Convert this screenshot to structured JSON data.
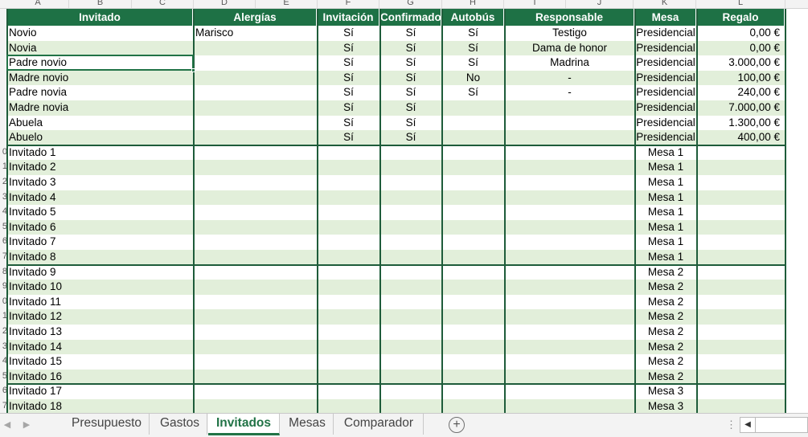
{
  "columns": [
    "A",
    "B",
    "C",
    "D",
    "E",
    "F",
    "G",
    "H",
    "I",
    "J",
    "K",
    "L"
  ],
  "headers": {
    "invitado": "Invitado",
    "alergias": "Alergías",
    "invitacion": "Invitación",
    "confirmado": "Confirmado",
    "autobus": "Autobús",
    "responsable": "Responsable",
    "mesa": "Mesa",
    "regalo": "Regalo"
  },
  "row_numbers": [
    "",
    "",
    "",
    "",
    "",
    "",
    "",
    "",
    "",
    "0",
    "1",
    "2",
    "3",
    "4",
    "5",
    "6",
    "7",
    "8",
    "9",
    "0",
    "1",
    "2",
    "3",
    "4",
    "5",
    "6",
    "7"
  ],
  "rows": [
    {
      "invitado": "Novio",
      "alergias": "Marisco",
      "invitacion": "Sí",
      "confirmado": "Sí",
      "autobus": "Sí",
      "responsable": "Testigo",
      "mesa": "Presidencial",
      "regalo": "0,00 €"
    },
    {
      "invitado": "Novia",
      "alergias": "",
      "invitacion": "Sí",
      "confirmado": "Sí",
      "autobus": "Sí",
      "responsable": "Dama de honor",
      "mesa": "Presidencial",
      "regalo": "0,00 €"
    },
    {
      "invitado": "Padre novio",
      "alergias": "",
      "invitacion": "Sí",
      "confirmado": "Sí",
      "autobus": "Sí",
      "responsable": "Madrina",
      "mesa": "Presidencial",
      "regalo": "3.000,00 €"
    },
    {
      "invitado": "Madre novio",
      "alergias": "",
      "invitacion": "Sí",
      "confirmado": "Sí",
      "autobus": "No",
      "responsable": "-",
      "mesa": "Presidencial",
      "regalo": "100,00 €"
    },
    {
      "invitado": "Padre novia",
      "alergias": "",
      "invitacion": "Sí",
      "confirmado": "Sí",
      "autobus": "Sí",
      "responsable": "-",
      "mesa": "Presidencial",
      "regalo": "240,00 €"
    },
    {
      "invitado": "Madre novia",
      "alergias": "",
      "invitacion": "Sí",
      "confirmado": "Sí",
      "autobus": "",
      "responsable": "",
      "mesa": "Presidencial",
      "regalo": "7.000,00 €"
    },
    {
      "invitado": "Abuela",
      "alergias": "",
      "invitacion": "Sí",
      "confirmado": "Sí",
      "autobus": "",
      "responsable": "",
      "mesa": "Presidencial",
      "regalo": "1.300,00 €"
    },
    {
      "invitado": "Abuelo",
      "alergias": "",
      "invitacion": "Sí",
      "confirmado": "Sí",
      "autobus": "",
      "responsable": "",
      "mesa": "Presidencial",
      "regalo": "400,00 €"
    },
    {
      "invitado": "Invitado 1",
      "alergias": "",
      "invitacion": "",
      "confirmado": "",
      "autobus": "",
      "responsable": "",
      "mesa": "Mesa 1",
      "regalo": ""
    },
    {
      "invitado": "Invitado 2",
      "alergias": "",
      "invitacion": "",
      "confirmado": "",
      "autobus": "",
      "responsable": "",
      "mesa": "Mesa 1",
      "regalo": ""
    },
    {
      "invitado": "Invitado 3",
      "alergias": "",
      "invitacion": "",
      "confirmado": "",
      "autobus": "",
      "responsable": "",
      "mesa": "Mesa 1",
      "regalo": ""
    },
    {
      "invitado": "Invitado 4",
      "alergias": "",
      "invitacion": "",
      "confirmado": "",
      "autobus": "",
      "responsable": "",
      "mesa": "Mesa 1",
      "regalo": ""
    },
    {
      "invitado": "Invitado 5",
      "alergias": "",
      "invitacion": "",
      "confirmado": "",
      "autobus": "",
      "responsable": "",
      "mesa": "Mesa 1",
      "regalo": ""
    },
    {
      "invitado": "Invitado 6",
      "alergias": "",
      "invitacion": "",
      "confirmado": "",
      "autobus": "",
      "responsable": "",
      "mesa": "Mesa 1",
      "regalo": ""
    },
    {
      "invitado": "Invitado 7",
      "alergias": "",
      "invitacion": "",
      "confirmado": "",
      "autobus": "",
      "responsable": "",
      "mesa": "Mesa 1",
      "regalo": ""
    },
    {
      "invitado": "Invitado 8",
      "alergias": "",
      "invitacion": "",
      "confirmado": "",
      "autobus": "",
      "responsable": "",
      "mesa": "Mesa 1",
      "regalo": ""
    },
    {
      "invitado": "Invitado 9",
      "alergias": "",
      "invitacion": "",
      "confirmado": "",
      "autobus": "",
      "responsable": "",
      "mesa": "Mesa 2",
      "regalo": ""
    },
    {
      "invitado": "Invitado 10",
      "alergias": "",
      "invitacion": "",
      "confirmado": "",
      "autobus": "",
      "responsable": "",
      "mesa": "Mesa 2",
      "regalo": ""
    },
    {
      "invitado": "Invitado 11",
      "alergias": "",
      "invitacion": "",
      "confirmado": "",
      "autobus": "",
      "responsable": "",
      "mesa": "Mesa 2",
      "regalo": ""
    },
    {
      "invitado": "Invitado 12",
      "alergias": "",
      "invitacion": "",
      "confirmado": "",
      "autobus": "",
      "responsable": "",
      "mesa": "Mesa 2",
      "regalo": ""
    },
    {
      "invitado": "Invitado 13",
      "alergias": "",
      "invitacion": "",
      "confirmado": "",
      "autobus": "",
      "responsable": "",
      "mesa": "Mesa 2",
      "regalo": ""
    },
    {
      "invitado": "Invitado 14",
      "alergias": "",
      "invitacion": "",
      "confirmado": "",
      "autobus": "",
      "responsable": "",
      "mesa": "Mesa 2",
      "regalo": ""
    },
    {
      "invitado": "Invitado 15",
      "alergias": "",
      "invitacion": "",
      "confirmado": "",
      "autobus": "",
      "responsable": "",
      "mesa": "Mesa 2",
      "regalo": ""
    },
    {
      "invitado": "Invitado 16",
      "alergias": "",
      "invitacion": "",
      "confirmado": "",
      "autobus": "",
      "responsable": "",
      "mesa": "Mesa 2",
      "regalo": ""
    },
    {
      "invitado": "Invitado 17",
      "alergias": "",
      "invitacion": "",
      "confirmado": "",
      "autobus": "",
      "responsable": "",
      "mesa": "Mesa 3",
      "regalo": ""
    },
    {
      "invitado": "Invitado 18",
      "alergias": "",
      "invitacion": "",
      "confirmado": "",
      "autobus": "",
      "responsable": "",
      "mesa": "Mesa 3",
      "regalo": ""
    }
  ],
  "sheet_tabs": [
    {
      "label": "Presupuesto",
      "active": false
    },
    {
      "label": "Gastos",
      "active": false
    },
    {
      "label": "Invitados",
      "active": true
    },
    {
      "label": "Mesas",
      "active": false
    },
    {
      "label": "Comparador",
      "active": false
    }
  ],
  "add_sheet_label": "+",
  "colors": {
    "header_green": "#1e7145",
    "band": "#e2efda",
    "border": "#1e5c3a",
    "accent": "#217346"
  }
}
